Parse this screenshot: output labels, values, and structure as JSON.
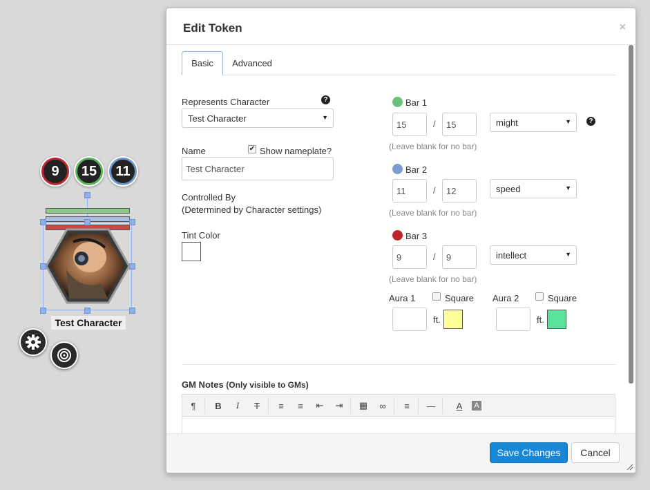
{
  "token": {
    "bubbles": [
      {
        "value": "9",
        "ring_color": "#c0272d"
      },
      {
        "value": "15",
        "ring_color": "#5ab45a"
      },
      {
        "value": "11",
        "ring_color": "#6f95c8"
      }
    ],
    "bar_colors": [
      "#8dc98a",
      "#a9bfe2",
      "#c94a4a"
    ],
    "name": "Test Character",
    "settings_icon": "gear-icon",
    "target_icon": "target-icon"
  },
  "dialog": {
    "title": "Edit Token",
    "close_label": "×",
    "tabs": [
      {
        "label": "Basic",
        "active": true
      },
      {
        "label": "Advanced",
        "active": false
      }
    ],
    "represents": {
      "label": "Represents Character",
      "value": "Test Character",
      "help_icon": "?"
    },
    "name": {
      "label": "Name",
      "value": "Test Character",
      "show_nameplate_label": "Show nameplate?",
      "show_nameplate_checked": true,
      "check_mark": "✔"
    },
    "controlled_by": {
      "label": "Controlled By",
      "note": "(Determined by Character settings)"
    },
    "tint": {
      "label": "Tint Color",
      "color": "#ffffff"
    },
    "bars": [
      {
        "label": "Bar 1",
        "color": "#6cc17a",
        "current": "15",
        "max": "15",
        "link": "might",
        "hint": "(Leave blank for no bar)",
        "help_icon": "?"
      },
      {
        "label": "Bar 2",
        "color": "#7a9fce",
        "current": "11",
        "max": "12",
        "link": "speed",
        "hint": "(Leave blank for no bar)"
      },
      {
        "label": "Bar 3",
        "color": "#c0252a",
        "current": "9",
        "max": "9",
        "link": "intellect",
        "hint": "(Leave blank for no bar)"
      }
    ],
    "slash": "/",
    "auras": [
      {
        "label": "Aura 1",
        "square_label": "Square",
        "radius": "",
        "unit": "ft.",
        "color": "#ffff99"
      },
      {
        "label": "Aura 2",
        "square_label": "Square",
        "radius": "",
        "unit": "ft.",
        "color": "#5be39a"
      }
    ],
    "gm_notes": {
      "label": "GM Notes",
      "sublabel": "(Only visible to GMs)",
      "toolbar": [
        {
          "name": "paragraph-icon",
          "glyph": "¶"
        },
        {
          "name": "bold-icon",
          "glyph": "B"
        },
        {
          "name": "italic-icon",
          "glyph": "I"
        },
        {
          "name": "strikethrough-icon",
          "glyph": "T"
        },
        {
          "name": "bullet-list-icon",
          "glyph": "≡"
        },
        {
          "name": "numbered-list-icon",
          "glyph": "≡"
        },
        {
          "name": "outdent-icon",
          "glyph": "⇤"
        },
        {
          "name": "indent-icon",
          "glyph": "⇥"
        },
        {
          "name": "table-icon",
          "glyph": "▦"
        },
        {
          "name": "link-icon",
          "glyph": "∞"
        },
        {
          "name": "align-icon",
          "glyph": "≡"
        },
        {
          "name": "horizontal-rule-icon",
          "glyph": "—"
        },
        {
          "name": "font-color-icon",
          "glyph": "A"
        },
        {
          "name": "highlight-color-icon",
          "glyph": "A"
        }
      ]
    },
    "footer": {
      "save_label": "Save Changes",
      "cancel_label": "Cancel"
    }
  }
}
